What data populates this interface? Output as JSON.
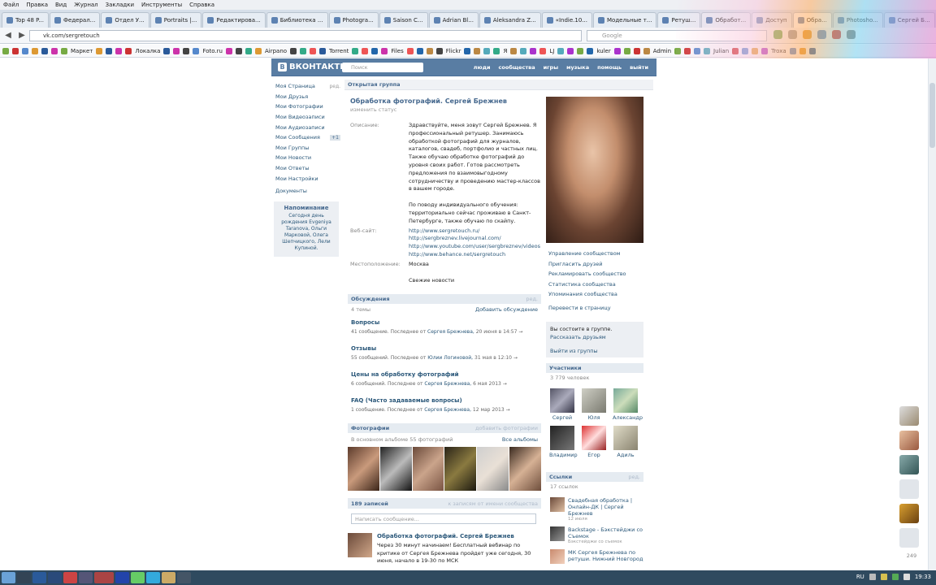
{
  "menu": [
    "Файл",
    "Правка",
    "Вид",
    "Журнал",
    "Закладки",
    "Инструменты",
    "Справка"
  ],
  "tabs": [
    "Top 48 P...",
    "Федерал...",
    "Отдел У...",
    "Portraits |...",
    "Редактирова...",
    "Библиотека ...",
    "Photogra...",
    "Saison C...",
    "Adrian Bl...",
    "Aleksandra Z...",
    "«Indie.10...",
    "Модельные т...",
    "Ретуш...",
    "Обработ...",
    "Доступ",
    "Обра...",
    "Photosho...",
    "Сергей Б..."
  ],
  "address": {
    "url": "vk.com/sergretouch",
    "search_placeholder": "Google"
  },
  "bookmarks": [
    "Маркет",
    "Локалка",
    "Foto.ru",
    "Airpano",
    "Torrent",
    "Files",
    "Flickr",
    "Я",
    "LJ",
    "kuler",
    "Admin",
    "Julian",
    "Troxa"
  ],
  "vk": {
    "logo": "ВКОНТАКТЕ",
    "logo_b": "В",
    "search": "Поиск",
    "nav": [
      "люди",
      "сообщества",
      "игры",
      "музыка",
      "помощь",
      "выйти"
    ],
    "left_menu": [
      {
        "label": "Моя Страница",
        "extra": "ред."
      },
      {
        "label": "Мои Друзья",
        "extra": ""
      },
      {
        "label": "Мои Фотографии",
        "extra": ""
      },
      {
        "label": "Мои Видеозаписи",
        "extra": ""
      },
      {
        "label": "Мои Аудиозаписи",
        "extra": ""
      },
      {
        "label": "Мои Сообщения",
        "extra": "+1"
      },
      {
        "label": "Мои Группы",
        "extra": ""
      },
      {
        "label": "Мои Новости",
        "extra": ""
      },
      {
        "label": "Мои Ответы",
        "extra": ""
      },
      {
        "label": "Мои Настройки",
        "extra": ""
      }
    ],
    "documents": "Документы",
    "reminder": {
      "title": "Напоминание",
      "text": "Сегодня день рождения Evgeniya Taranova, Ольги Марковой, Олега Шепчицкого, Лели Купиной."
    },
    "breadcrumb": "Открытая группа",
    "group_title": "Обработка фотографий. Сергей Брежнев",
    "group_status": "изменить статус",
    "description_label": "Описание:",
    "description": "Здравствуйте, меня зовут Сергей Брежнев. Я профессиональный ретушер. Занимаюсь обработкой фотографий для журналов, каталогов, свадеб, портфолио и частных лиц. Также обучаю обработке фотографий до уровня своих работ. Готов рассмотреть предложения по взаимовыгодному сотрудничеству и проведению мастер-классов в вашем городе.",
    "description2": "По поводу индивидуального обучения: территориально сейчас проживаю в Санкт-Петербурге, также обучаю по скайпу.",
    "website_label": "Веб-сайт:",
    "websites": [
      "http://www.sergretouch.ru/",
      "http://sergbreznev.livejournal.com/",
      "http://www.youtube.com/user/sergbreznev/videos",
      "http://www.behance.net/sergretouch"
    ],
    "location_label": "Местоположение:",
    "location": "Москва",
    "fresh_news": "Свежие новости",
    "discussions": {
      "title": "Обсуждения",
      "edit": "ред.",
      "count": "4 темы",
      "add": "Добавить обсуждение"
    },
    "topics": [
      {
        "title": "Вопросы",
        "meta": "41 сообщение. Последнее от ",
        "author": "Сергея Брежнева,",
        "date": " 20 июня в 14:57 →"
      },
      {
        "title": "Отзывы",
        "meta": "55 сообщений. Последнее от ",
        "author": "Юлии Логиновой,",
        "date": " 31 мая в 12:10 →"
      },
      {
        "title": "Цены на обработку фотографий",
        "meta": "6 сообщений. Последнее от ",
        "author": "Сергея Брежнева,",
        "date": " 6 мая 2013 →"
      },
      {
        "title": "FAQ (Часто задаваемые вопросы)",
        "meta": "1 сообщение. Последнее от ",
        "author": "Сергея Брежнева,",
        "date": " 12 мар 2013 →"
      }
    ],
    "photos": {
      "title": "Фотографии",
      "add": "добавить фотографии",
      "album": "В основном альбоме 55 фотографий",
      "all": "Все альбомы"
    },
    "wall": {
      "count": "189 записей",
      "filter": "к записям от имени сообщества",
      "placeholder": "Написать сообщение..."
    },
    "post": {
      "author": "Обработка фотографий. Сергей Брежнев",
      "text": "Через 30 минут начинаем! Бесплатный вебинар по критике от Сергея Брежнева пройдет уже сегодня, 30 июня, начало в 19-30 по МСК"
    },
    "right_links": [
      "Управление сообществом",
      "Пригласить друзей",
      "Рекламировать сообщество",
      "Статистика сообщества",
      "Упоминания сообщества"
    ],
    "goto_page": "Перевести в страницу",
    "member_box": {
      "status": "Вы состоите в группе.",
      "tell": "Рассказать друзьям",
      "leave": "Выйти из группы"
    },
    "members": {
      "title": "Участники",
      "count": "3 779 человек",
      "list": [
        "Сергей",
        "Юля",
        "Александр",
        "Владимир",
        "Егор",
        "Адиль"
      ]
    },
    "links": {
      "title": "Ссылки",
      "edit": "ред.",
      "count": "17 ссылок",
      "list": [
        {
          "title": "Свадебная обработка | Онлайн-ДК | Сергей Брежнев",
          "sub": "12 июля"
        },
        {
          "title": "Backstage - Бэкстейджи со Съемок",
          "sub": "Бэкстейджи со съемок"
        },
        {
          "title": "МК Сергея Брежнева по ретуши. Нижний Новгород",
          "sub": ""
        }
      ]
    },
    "dock_count": "249"
  },
  "clock": "19:33",
  "lang": "RU"
}
